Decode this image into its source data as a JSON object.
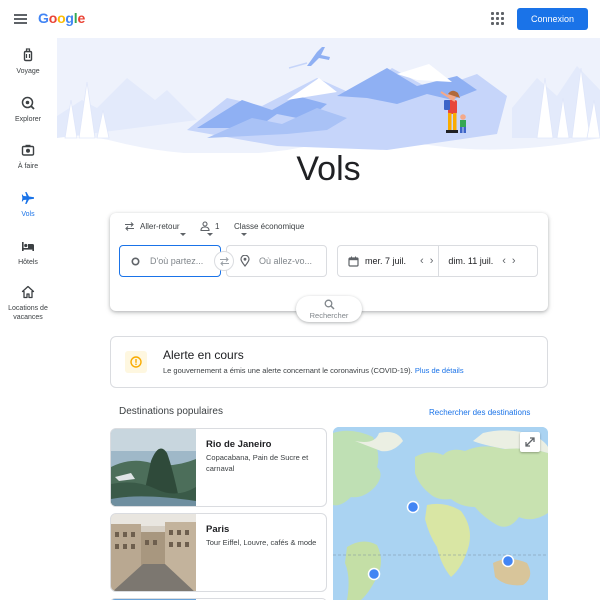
{
  "header": {
    "logo_letters": [
      "G",
      "o",
      "o",
      "g",
      "l",
      "e"
    ],
    "logo_colors": [
      "#4285f4",
      "#ea4335",
      "#fbbc05",
      "#4285f4",
      "#34a853",
      "#ea4335"
    ],
    "signin_label": "Connexion"
  },
  "nav": {
    "items": [
      {
        "label": "Voyage",
        "icon": "luggage-icon"
      },
      {
        "label": "Explorer",
        "icon": "explore-icon"
      },
      {
        "label": "À faire",
        "icon": "camera-icon"
      },
      {
        "label": "Vols",
        "icon": "flight-icon",
        "active": true
      },
      {
        "label": "Hôtels",
        "icon": "hotel-icon"
      },
      {
        "label": "Locations de vacances",
        "icon": "home-icon"
      }
    ]
  },
  "page": {
    "title": "Vols"
  },
  "search": {
    "trip_type": "Aller-retour",
    "passengers": "1",
    "cabin_class": "Classe économique",
    "origin_placeholder": "D'où partez...",
    "destination_placeholder": "Où allez-vo...",
    "depart_date": "mer. 7 juil.",
    "return_date": "dim. 11 juil.",
    "search_label": "Rechercher"
  },
  "alert": {
    "title": "Alerte en cours",
    "text": "Le gouvernement a émis une alerte concernant le coronavirus (COVID-19).",
    "link": "Plus de détails"
  },
  "destinations": {
    "heading": "Destinations populaires",
    "link": "Rechercher des destinations",
    "items": [
      {
        "name": "Rio de Janeiro",
        "description": "Copacabana, Pain de Sucre et carnaval"
      },
      {
        "name": "Paris",
        "description": "Tour Eiffel, Louvre, cafés & mode"
      }
    ]
  },
  "colors": {
    "accent": "#1a73e8",
    "alert_icon": "#f9ab00"
  }
}
